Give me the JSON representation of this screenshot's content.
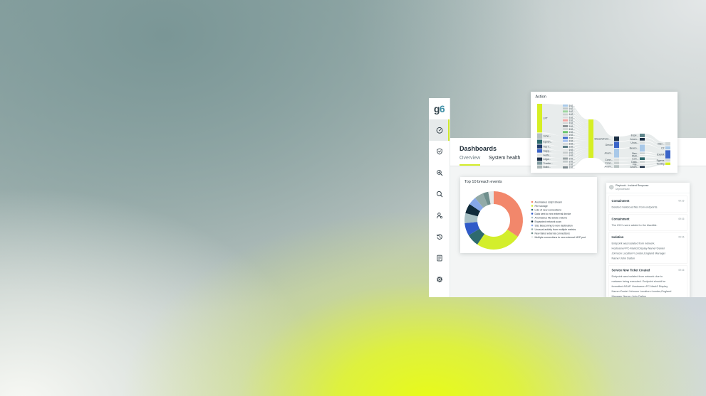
{
  "brand": {
    "logo": "g6",
    "accent": "#d3ec2a"
  },
  "sidebar": {
    "items": [
      {
        "icon": "dashboard-gauge-icon",
        "active": true
      },
      {
        "icon": "shield-icon",
        "active": false
      },
      {
        "icon": "zoom-in-icon",
        "active": false
      },
      {
        "icon": "search-icon",
        "active": false
      },
      {
        "icon": "user-icon",
        "active": false
      },
      {
        "icon": "history-icon",
        "active": false
      },
      {
        "icon": "report-icon",
        "active": false
      },
      {
        "icon": "settings-icon",
        "active": false
      }
    ]
  },
  "header": {
    "title": "Dashboards",
    "tabs": [
      "Overview",
      "System health"
    ]
  },
  "action_card": {
    "title": "Action",
    "columns": [
      [
        {
          "label": "LPT",
          "value": 15,
          "color": "#d6ef24"
        },
        {
          "label": "Sche...",
          "value": 3,
          "color": "#b5c1c1"
        },
        {
          "label": "Epoch...",
          "value": 2.2,
          "color": "#2e6a6e"
        },
        {
          "label": "Top f...",
          "value": 2,
          "color": "#1d3a6a"
        },
        {
          "label": "Sapp...",
          "value": 1.8,
          "color": "#3a64c8"
        },
        {
          "label": "Authi...",
          "value": 1.8,
          "color": "#dde2e2"
        },
        {
          "label": "Lega...",
          "value": 1.8,
          "color": "#1b2e44"
        },
        {
          "label": "Tracke...",
          "value": 1.6,
          "color": "#7f9ba0"
        },
        {
          "label": "Build...",
          "value": 1.6,
          "color": "#aab6b6"
        }
      ],
      [
        {
          "label": "192...",
          "value": 1,
          "color": "#a9c9e8"
        },
        {
          "label": "192...",
          "value": 1,
          "color": "#c0c8c8"
        },
        {
          "label": "192...",
          "value": 1,
          "color": "#9fd5a2"
        },
        {
          "label": "192...",
          "value": 1,
          "color": "#cbd0d0"
        },
        {
          "label": "192...",
          "value": 1,
          "color": "#d9dddd"
        },
        {
          "label": "192...",
          "value": 1,
          "color": "#f1a6a3"
        },
        {
          "label": "192...",
          "value": 1,
          "color": "#d2d6d6"
        },
        {
          "label": "192...",
          "value": 1,
          "color": "#8d9497"
        },
        {
          "label": "192...",
          "value": 1,
          "color": "#d4d8d8"
        },
        {
          "label": "192...",
          "value": 1,
          "color": "#6cc56f"
        },
        {
          "label": "192...",
          "value": 1,
          "color": "#cfd3d3"
        },
        {
          "label": "192...",
          "value": 1,
          "color": "#3d6bcc"
        },
        {
          "label": "192...",
          "value": 1,
          "color": "#a8c3ef"
        },
        {
          "label": "192...",
          "value": 1,
          "color": "#d7dbdb"
        },
        {
          "label": "192...",
          "value": 1,
          "color": "#5d7f86"
        },
        {
          "label": "192...",
          "value": 1,
          "color": "#e3e6e6"
        },
        {
          "label": "192...",
          "value": 1,
          "color": "#c6cccc"
        },
        {
          "label": "192...",
          "value": 1,
          "color": "#dfe2e2"
        },
        {
          "label": "192...",
          "value": 1,
          "color": "#9aa4a6"
        },
        {
          "label": "192...",
          "value": 1,
          "color": "#c2c9ca"
        },
        {
          "label": "192...",
          "value": 1,
          "color": "#e6e8e8"
        },
        {
          "label": "192...",
          "value": 1,
          "color": "#7f8c90"
        }
      ],
      [
        {
          "label": "Breach/Incid...",
          "value": 20,
          "color": "#d6ef24"
        }
      ],
      [
        {
          "label": "",
          "value": 2.5,
          "color": "#1b2e44"
        },
        {
          "label": "Device",
          "value": 3.5,
          "color": "#3a64c8"
        },
        {
          "label": "Anom...",
          "value": 5,
          "color": "#a8c8e8"
        },
        {
          "label": "Conn...",
          "value": 1.5,
          "color": "#d7dcdc"
        },
        {
          "label": "Conn...",
          "value": 1.5,
          "color": "#c8cfcf"
        },
        {
          "label": "Anom...",
          "value": 1.5,
          "color": "#b8c2c2"
        }
      ],
      [
        {
          "label": "Expe...",
          "value": 2,
          "color": "#5e858b"
        },
        {
          "label": "Anom...",
          "value": 1.5,
          "color": "#1b2e44"
        },
        {
          "label": "Unus...",
          "value": 1.5,
          "color": "#d7dcdc"
        },
        {
          "label": "Beaco...",
          "value": 4,
          "color": "#a8c8e8"
        },
        {
          "label": "Bea...",
          "value": 1,
          "color": "#c8cfcf"
        },
        {
          "label": "Mult...",
          "value": 1,
          "color": "#e2e5e5"
        },
        {
          "label": "Low...",
          "value": 1.5,
          "color": "#2e6a6e"
        },
        {
          "label": "Data...",
          "value": 1.2,
          "color": "#cfd5d5"
        },
        {
          "label": "File...",
          "value": 1,
          "color": "#e6e8e8"
        },
        {
          "label": "Anom...",
          "value": 1,
          "color": "#1b2e44"
        }
      ],
      [
        {
          "label": "Inter...",
          "value": 2,
          "color": "#d1d7d7"
        },
        {
          "label": "C2",
          "value": 2,
          "color": "#a8c8e8"
        },
        {
          "label": "Exploit",
          "value": 5,
          "color": "#3a64c8"
        },
        {
          "label": "Egress",
          "value": 1.5,
          "color": "#d1d7d7"
        },
        {
          "label": "Tooling",
          "value": 1.5,
          "color": "#d6ef24"
        }
      ]
    ]
  },
  "chart_data": {
    "type": "pie",
    "donut": true,
    "title": "Top 10 breach events",
    "legend": "right",
    "categories": [
      "Anomalous script stream",
      "File storage",
      "Lots of new connections",
      "Data sent to new external device",
      "Anomalous file delete volume",
      "Expanded network scan",
      "SSL Beaconing to new destination",
      "Unusual activity from multiple metrics",
      "New failed external connections",
      "Multiple connections to new external UDP port"
    ],
    "values": [
      34.5,
      25,
      7,
      7,
      5.5,
      5.5,
      4.5,
      5,
      3,
      3
    ],
    "colors": [
      "#f2876b",
      "#d3ee2c",
      "#2e6a6e",
      "#2f5ac8",
      "#a6bfc4",
      "#0f2a3a",
      "#86a7e8",
      "#92aaa8",
      "#6f8f8d",
      "#e4e8e8"
    ]
  },
  "playbook": {
    "title": "Playbook - Incident Response",
    "status": "Unprocessed",
    "items": [
      {
        "title": "Containment",
        "time": "09:16",
        "description": "Deleted malicious files from endpoints."
      },
      {
        "title": "Containment",
        "time": "09:16",
        "description": "The IOC's were added to the blacklist."
      },
      {
        "title": "Isolation",
        "time": "09:16",
        "description": "Endpoint was isolated from network. Hostname=PC-Mark3 Display Name=Daniel Johnson Location=London,England Manager Name=John Dalton"
      },
      {
        "title": "Service Now Ticket Created",
        "time": "09:16",
        "description": "Endpoint was isolated from network due to malware being executed. Endpoint should be formatted ASAP. Hostname=PC-Mark3 Display Name=Daniel Johnson Location=London,England Manager Name=John Dalton"
      }
    ]
  }
}
